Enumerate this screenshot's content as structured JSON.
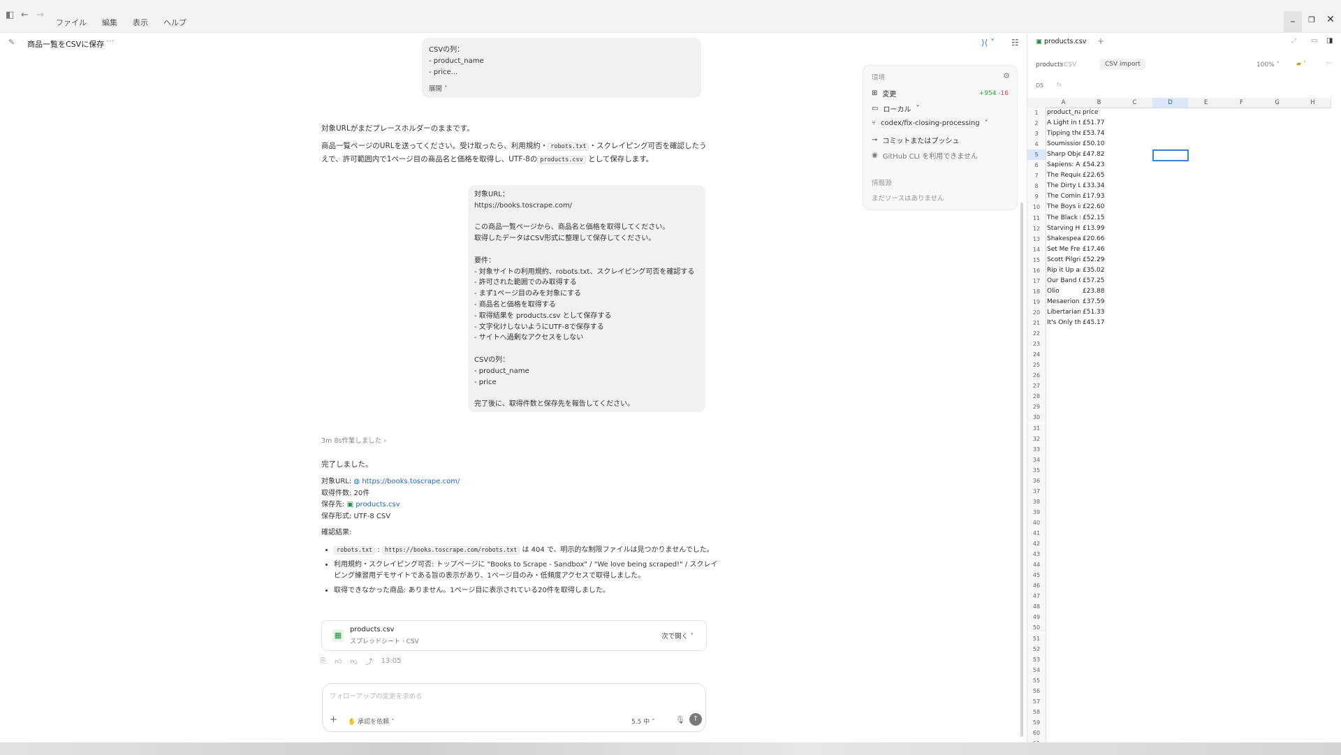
{
  "menu": [
    "ファイル",
    "編集",
    "表示",
    "ヘルプ"
  ],
  "chat": {
    "title": "商品一覧をCSVに保存",
    "top_bubble": "CSVの列：\n- product_name\n- price...",
    "expand": "展開",
    "assistant_msg1": "対象URLがまだプレースホルダーのままです。",
    "assistant_msg2_a": "商品一覧ページのURLを送ってください。受け取ったら、利用規約・",
    "assistant_msg2_code1": "robots.txt",
    "assistant_msg2_b": "・スクレイピング可否を確認したうえで、許可範囲内で1ページ目の商品名と価格を取得し、UTF-8の",
    "assistant_msg2_code2": "products.csv",
    "assistant_msg2_c": "として保存します。",
    "user_bubble": "対象URL：\nhttps://books.toscrape.com/\n\nこの商品一覧ページから、商品名と価格を取得してください。\n取得したデータはCSV形式に整理して保存してください。\n\n要件：\n- 対象サイトの利用規約、robots.txt、スクレイピング可否を確認する\n- 許可された範囲でのみ取得する\n- まず1ページ目のみを対象にする\n- 商品名と価格を取得する\n- 取得結果を products.csv として保存する\n- 文字化けしないようにUTF-8で保存する\n- サイトへ過剰なアクセスをしない\n\nCSVの列：\n- product_name\n- price\n\n完了後に、取得件数と保存先を報告してください。",
    "worked": "3m 8s作業しました",
    "done": "完了しました。",
    "target_label": "対象URL:",
    "target_url": "https://books.toscrape.com/",
    "count_line": "取得件数: 20件",
    "save_label": "保存先:",
    "save_file": "products.csv",
    "format_line": "保存形式: UTF-8 CSV",
    "check_title": "確認結果:",
    "bullet1_code1": "robots.txt",
    "bullet1_code2": "https://books.toscrape.com/robots.txt",
    "bullet1_text": "は 404 で、明示的な制限ファイルは見つかりませんでした。",
    "bullet2": "利用規約・スクレイピング可否: トップページに \"Books to Scrape - Sandbox\" / \"We love being scraped!\" / スクレイピング練習用デモサイトである旨の表示があり、1ページ目のみ・低頻度アクセスで取得しました。",
    "bullet3": "取得できなかった商品: ありません。1ページ目に表示されている20件を取得しました。",
    "file_name": "products.csv",
    "file_sub": "スプレッドシート · CSV",
    "open_next": "次で開く",
    "time": "13:05",
    "composer_placeholder": "フォローアップの変更を求める",
    "approval": "承認を依頼",
    "model": "5.5 中"
  },
  "env": {
    "title": "環境",
    "changes": "変更",
    "additions": "+954",
    "deletions": "-16",
    "local": "ローカル",
    "branch": "codex/fix-closing-processing",
    "commit": "コミットまたはプッシュ",
    "github": "GitHub CLI を利用できません",
    "info_title": "情報源",
    "no_source": "まだソースはありません"
  },
  "sheet": {
    "tab": "products.csv",
    "doc_name": "products",
    "doc_type": "CSV",
    "import_btn": "CSV import",
    "zoom": "100%",
    "cell_ref": "D5",
    "columns": [
      "A",
      "B",
      "C",
      "D",
      "E",
      "F",
      "G",
      "H"
    ],
    "header_row": [
      "product_na",
      "price"
    ],
    "rows": [
      [
        "A Light in t",
        "£51.77"
      ],
      [
        "Tipping the",
        "£53.74"
      ],
      [
        "Soumission",
        "£50.10"
      ],
      [
        "Sharp Obje",
        "£47.82"
      ],
      [
        "Sapiens: A",
        "£54.23"
      ],
      [
        "The Requie",
        "£22.65"
      ],
      [
        "The Dirty L",
        "£33.34"
      ],
      [
        "The Comin",
        "£17.93"
      ],
      [
        "The Boys ir",
        "£22.60"
      ],
      [
        "The Black M",
        "£52.15"
      ],
      [
        "Starving He",
        "£13.99"
      ],
      [
        "Shakespea",
        "£20.66"
      ],
      [
        "Set Me Fre",
        "£17.46"
      ],
      [
        "Scott Pilgri",
        "£52.29"
      ],
      [
        "Rip it Up ar",
        "£35.02"
      ],
      [
        "Our Band C",
        "£57.25"
      ],
      [
        "Olio",
        "£23.88"
      ],
      [
        "Mesaerion",
        "£37.59"
      ],
      [
        "Libertarian",
        "£51.33"
      ],
      [
        "It's Only th",
        "£45.17"
      ]
    ],
    "total_rows": 61
  }
}
